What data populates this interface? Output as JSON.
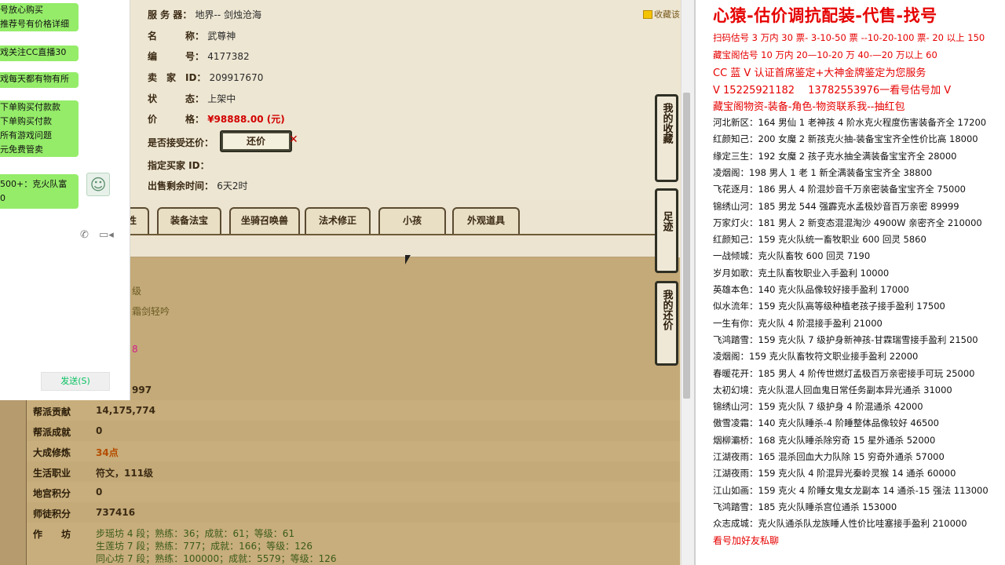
{
  "listing": {
    "server_label": "服 务 器：",
    "server_value": "地界-- 剑烛沧海",
    "name_label": "名　　　称：",
    "name_value": "武尊神",
    "id_label": "编　　　号：",
    "id_value": "4177382",
    "seller_label": "卖　家　ID：",
    "seller_value": "209917670",
    "status_label": "状　　　态：",
    "status_value": "上架中",
    "price_label": "价　　　格：",
    "price_value": "¥98888.00 (元)",
    "offer_label": "是否接受还价：",
    "offer_button": "还价",
    "offer_close": "✕",
    "buyer_label": "指定买家 ID：",
    "buyer_value": "",
    "time_label": "出售剩余时间：",
    "time_value": "6天2时",
    "favorite": "收藏该"
  },
  "tabs": [
    "性",
    "装备法宝",
    "坐骑召唤兽",
    "法术修正",
    "小孩",
    "外观道具"
  ],
  "side_buttons": [
    {
      "label": "我的收藏"
    },
    {
      "label": "足迹"
    },
    {
      "label": "我的还价"
    }
  ],
  "detail": {
    "fragments": [
      "级",
      "霜剑轻吟",
      "8",
      "997"
    ],
    "rows": [
      {
        "key": "帮派贡献",
        "value": "14,175,774"
      },
      {
        "key": "帮派成就",
        "value": "0"
      },
      {
        "key": "大成修炼",
        "value": "34点"
      },
      {
        "key": "生活职业",
        "value": "符文，111级"
      },
      {
        "key": "地宫积分",
        "value": "0"
      },
      {
        "key": "师徒积分",
        "value": "737416"
      }
    ],
    "workshop_key": "作　　坊",
    "workshops": [
      "步瑶坊 4 段；熟练：36；成就：61；等级：61",
      "生莲坊 7 段；熟练：777；成就：166；等级：126",
      "同心坊 7 段；熟练：100000；成就：5579；等级：126"
    ]
  },
  "chat": {
    "bubbles": [
      "号放心购买",
      "推荐号有价格详细",
      "戏关注CC直播30",
      "戏每天都有物有所",
      "下单购买付款款",
      "下单购买付款",
      "所有游戏问题",
      "元免费管卖",
      "500+：克火队富",
      "0"
    ],
    "send_button": "发送(S)",
    "phone_icon": "phone-icon",
    "video_icon": "video-icon"
  },
  "doc": {
    "title": "心猿-估价调抗配装-代售-找号",
    "header_lines": [
      "扫码估号 3 万内 30 票- 3-10-50 票 --10-20-100 票- 20 以上 150",
      "藏宝阁估号 10 万内 20—10-20 万 40-—20 万以上 60",
      "CC 蓝 V 认证首席鉴定+大神金牌鉴定为您服务",
      "V 15225921182　 13782553976一看号估号加 V",
      "藏宝阁物资-装备-角色-物资联系我--抽红包"
    ],
    "entries": [
      "河北新区：164 男仙 1 老神孩 4 阶水克火程度伤害装备齐全 17200",
      "红颜知己：200 女魔 2 新孩克火抽-装备宝宝齐全性价比高 18000",
      "缘定三生：192 女魔 2 孩子克水抽全满装备宝宝齐全 28000",
      "凌烟阁：198 男人 1 老 1 新全满装备宝宝齐全 38800",
      "飞花逐月：186 男人 4 阶混妙音千万亲密装备宝宝齐全 75000",
      "锦绣山河：185 男龙 544 强霹克水孟极妙音百万亲密 89999",
      "万家灯火：181 男人 2 新变态混混淘沙 4900W 亲密齐全 210000",
      "红颜知己：159 克火队统一畜牧职业 600 回灵 5860",
      "一战倾城：克火队畜牧 600 回灵 7190",
      "岁月如歌：克土队畜牧职业入手盈利 10000",
      "英雄本色：140 克火队品像较好接手盈利 17000",
      "似水流年：159 克火队高等级种植老孩子接手盈利 17500",
      "一生有你：克火队 4 阶混接手盈利 21000",
      "飞鸿踏雪：159 克火队 7 级护身新神孩-甘霖瑞雪接手盈利 21500",
      "凌烟阁：159 克火队畜牧符文职业接手盈利 22000",
      "春暖花开：185 男人 4 阶传世燃灯孟极百万亲密接手可玩 25000",
      "太初幻境：克火队混人回血鬼日常任务副本异光通杀 31000",
      "锦绣山河：159 克火队 7 级护身 4 阶混通杀 42000",
      "傲雪凌霜：140 克火队睡杀-4 阶睡整体品像较好 46500",
      "烟柳灞桥：168 克火队睡杀除穷奇 15 星外通杀 52000",
      "江湖夜雨：165 混杀回血大力队除 15 穷奇外通杀 57000",
      "江湖夜雨：159 克火队 4 阶混异光秦岭灵猴 14 通杀 60000",
      "江山如画：159 克火 4 阶睡女鬼女龙副本 14 通杀-15 强法 113000",
      "飞鸿踏雪：185 克火队睡杀宫位通杀 153000",
      "众志成城：克火队通杀队龙族睡人性价比哇塞接手盈利 210000"
    ],
    "footer": "看号加好友私聊"
  },
  "colors": {
    "accent_red": "#e60000",
    "chat_bubble": "#95ec69",
    "panel_tan": "#c4aa78"
  }
}
